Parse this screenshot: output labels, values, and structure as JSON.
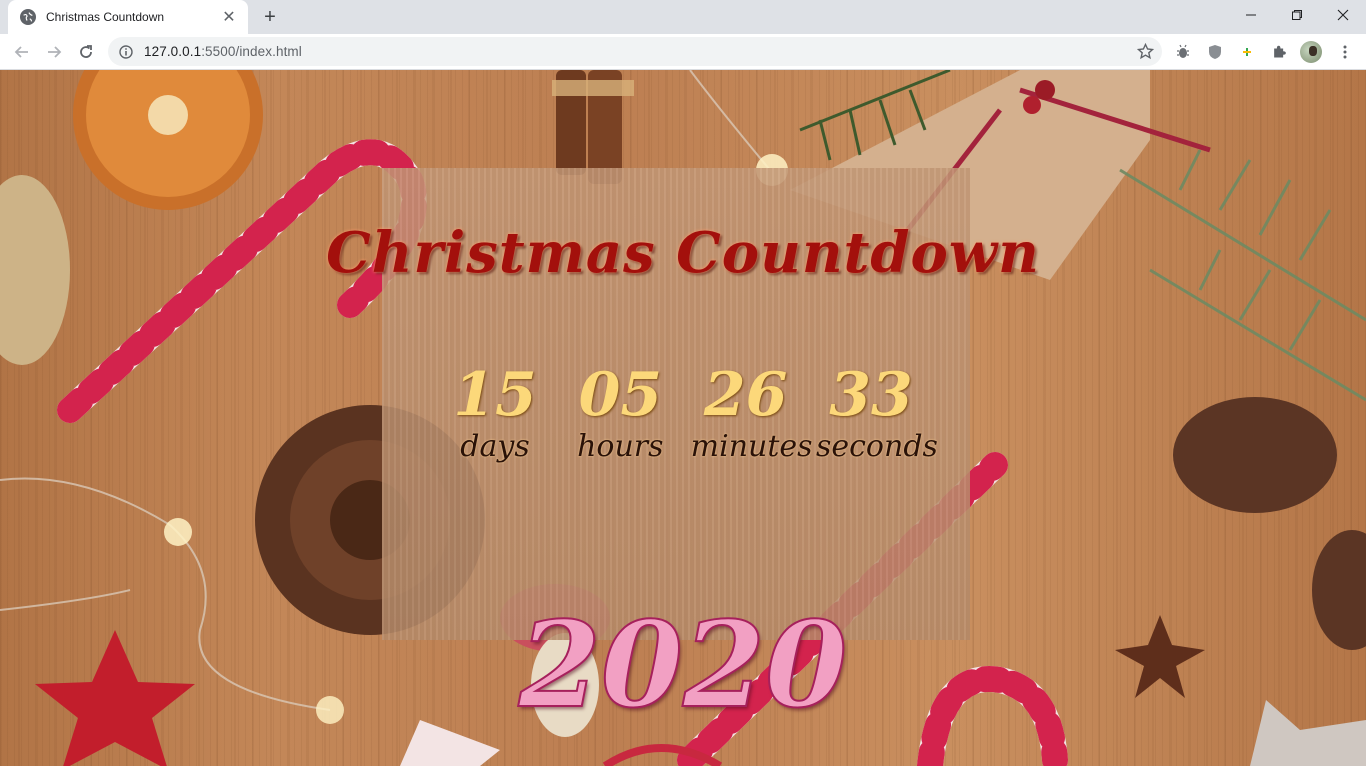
{
  "browser": {
    "tab_title": "Christmas Countdown",
    "url_host": "127.0.0.1",
    "url_rest": ":5500/index.html",
    "close_tab_glyph": "✕",
    "new_tab_glyph": "+"
  },
  "page": {
    "heading": "Christmas Countdown",
    "countdown": [
      {
        "value": "15",
        "label": "days"
      },
      {
        "value": "05",
        "label": "hours"
      },
      {
        "value": "26",
        "label": "minutes"
      },
      {
        "value": "33",
        "label": "seconds"
      }
    ],
    "year": "2020"
  },
  "colors": {
    "heading": "#a3100c",
    "numbers": "#fcd87a",
    "labels": "#2a1208",
    "year_fill": "#f2a0c3",
    "year_stroke": "#a6205c"
  }
}
